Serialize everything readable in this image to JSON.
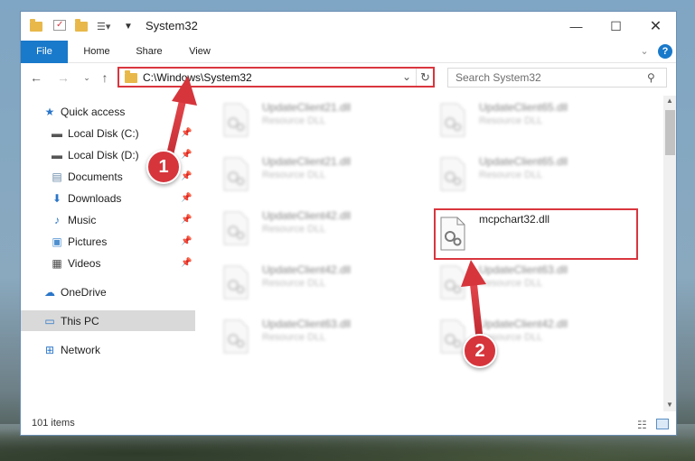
{
  "window": {
    "title": "System32"
  },
  "ribbon": {
    "tabs": [
      "File",
      "Home",
      "Share",
      "View"
    ]
  },
  "address": {
    "path": "C:\\Windows\\System32"
  },
  "search": {
    "placeholder": "Search System32"
  },
  "sidebar": {
    "items": [
      {
        "label": "Quick access",
        "icon": "star-icon"
      },
      {
        "label": "Local Disk (C:)",
        "icon": "drive-icon"
      },
      {
        "label": "Local Disk (D:)",
        "icon": "drive-icon"
      },
      {
        "label": "Documents",
        "icon": "documents-icon"
      },
      {
        "label": "Downloads",
        "icon": "download-icon"
      },
      {
        "label": "Music",
        "icon": "music-icon"
      },
      {
        "label": "Pictures",
        "icon": "pictures-icon"
      },
      {
        "label": "Videos",
        "icon": "videos-icon"
      },
      {
        "label": "OneDrive",
        "icon": "cloud-icon"
      },
      {
        "label": "This PC",
        "icon": "computer-icon"
      },
      {
        "label": "Network",
        "icon": "network-icon"
      }
    ]
  },
  "files": [
    {
      "name": "UpdateClient21.dll",
      "type": "Resource DLL"
    },
    {
      "name": "UpdateClient65.dll",
      "type": "Resource DLL"
    },
    {
      "name": "UpdateClient21.dll",
      "type": "Resource DLL"
    },
    {
      "name": "UpdateClient65.dll",
      "type": "Resource DLL"
    },
    {
      "name": "UpdateClient42.dll",
      "type": "Resource DLL"
    },
    {
      "name": "mcpchart32.dll",
      "type": ""
    },
    {
      "name": "UpdateClient42.dll",
      "type": "Resource DLL"
    },
    {
      "name": "UpdateClient63.dll",
      "type": "Resource DLL"
    },
    {
      "name": "UpdateClient63.dll",
      "type": "Resource DLL"
    },
    {
      "name": "UpdateClient42.dll",
      "type": "Resource DLL"
    }
  ],
  "status": {
    "item_count": "101 items"
  },
  "annotations": {
    "step1": "1",
    "step2": "2"
  },
  "colors": {
    "accent": "#1979ca",
    "highlight": "#d9363e"
  }
}
